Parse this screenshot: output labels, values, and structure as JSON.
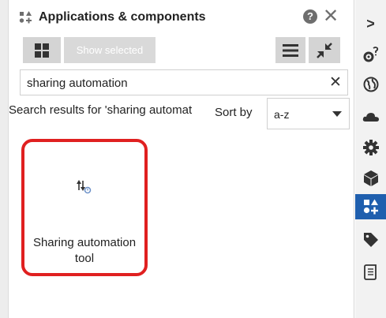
{
  "panel": {
    "title": "Applications & components",
    "help_label": "?",
    "close_label": "✕"
  },
  "toolbar": {
    "show_selected_label": "Show selected"
  },
  "search": {
    "value": "sharing automation",
    "clear_label": "✕"
  },
  "results": {
    "label": "Search results for 'sharing automat",
    "sort_by_label": "Sort by",
    "sort_value": "a-z"
  },
  "result_items": [
    {
      "label": "Sharing automation tool",
      "icon": "sharing-automation-icon"
    }
  ],
  "sidebar": {
    "expand_label": ">",
    "items": [
      {
        "icon": "expand-chevron-icon"
      },
      {
        "icon": "settings-help-icon"
      },
      {
        "icon": "globe-icon"
      },
      {
        "icon": "cloud-icon"
      },
      {
        "icon": "gear-icon"
      },
      {
        "icon": "cube-icon"
      },
      {
        "icon": "apps-components-icon",
        "active": true
      },
      {
        "icon": "tag-icon"
      },
      {
        "icon": "scroll-icon"
      }
    ]
  },
  "colors": {
    "highlight_border": "#e02020",
    "active_sidebar": "#1f5fae",
    "button_bg": "#d4d4d4"
  }
}
